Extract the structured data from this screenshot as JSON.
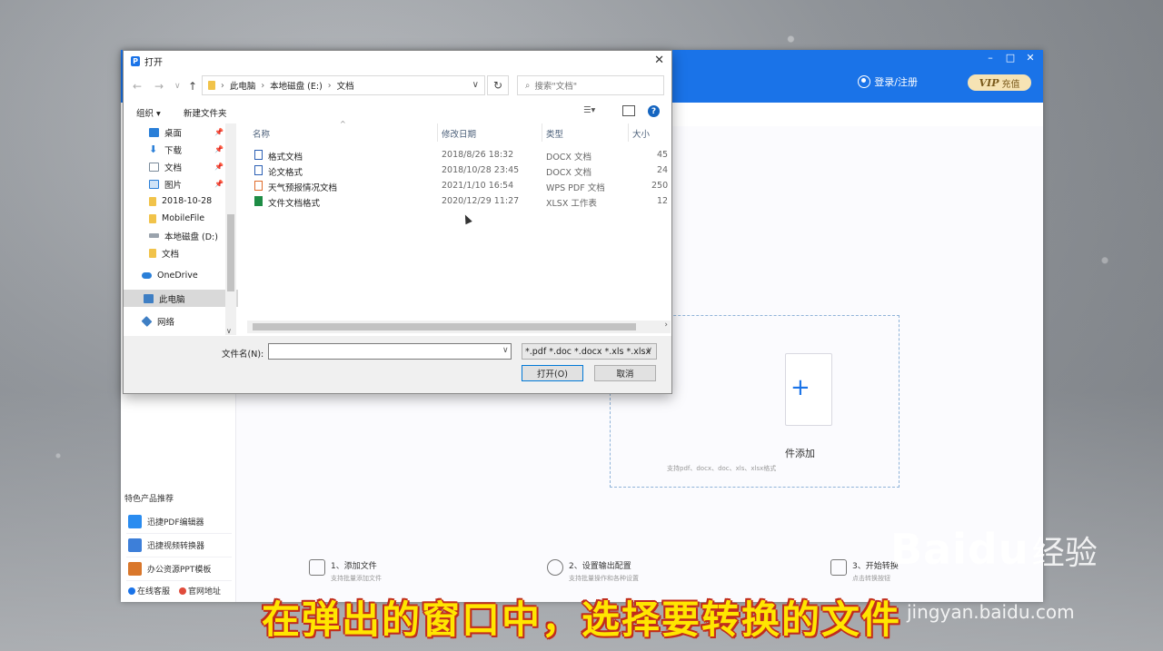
{
  "dialog": {
    "title": "打开",
    "close": "✕",
    "breadcrumb": [
      "此电脑",
      "本地磁盘 (E:)",
      "文档"
    ],
    "search_placeholder": "搜索\"文档\"",
    "toolbar": {
      "organize": "组织 ▾",
      "new_folder": "新建文件夹",
      "help": "?"
    },
    "nav": [
      {
        "label": "桌面",
        "icon": "desktop-icon",
        "pinned": true
      },
      {
        "label": "下载",
        "icon": "download-icon",
        "pinned": true
      },
      {
        "label": "文档",
        "icon": "documents-icon",
        "pinned": true
      },
      {
        "label": "图片",
        "icon": "pictures-icon",
        "pinned": true
      },
      {
        "label": "2018-10-28",
        "icon": "folder-icon",
        "pinned": false
      },
      {
        "label": "MobileFile",
        "icon": "folder-icon",
        "pinned": false
      },
      {
        "label": "本地磁盘 (D:)",
        "icon": "drive-icon",
        "pinned": false
      },
      {
        "label": "文档",
        "icon": "folder-icon",
        "pinned": false
      },
      {
        "label": "OneDrive",
        "icon": "onedrive-icon",
        "pinned": false
      },
      {
        "label": "此电脑",
        "icon": "computer-icon",
        "pinned": false
      },
      {
        "label": "网络",
        "icon": "network-icon",
        "pinned": false
      }
    ],
    "columns": {
      "name": "名称",
      "date": "修改日期",
      "type": "类型",
      "size": "大小"
    },
    "files": [
      {
        "name": "格式文档",
        "date": "2018/8/26 18:32",
        "type": "DOCX 文档",
        "size": "45",
        "color": "#2b5fb4"
      },
      {
        "name": "论文格式",
        "date": "2018/10/28 23:45",
        "type": "DOCX 文档",
        "size": "24",
        "color": "#2b5fb4"
      },
      {
        "name": "天气预报情况文档",
        "date": "2021/1/10 16:54",
        "type": "WPS PDF 文档",
        "size": "250",
        "color": "#e06b2a"
      },
      {
        "name": "文件文档格式",
        "date": "2020/12/29 11:27",
        "type": "XLSX 工作表",
        "size": "12",
        "color": "#1e8c45"
      }
    ],
    "filename_label": "文件名(N):",
    "filename_value": "",
    "filter": "*.pdf *.doc *.docx *.xls *.xlsx",
    "open_btn": "打开(O)",
    "cancel_btn": "取消"
  },
  "app": {
    "window_controls": [
      "–",
      "□",
      "✕"
    ],
    "login": "登录/注册",
    "vip": "VIP",
    "vip_suffix": "充值",
    "add_file_text": "件添加",
    "add_file_sub": "支持pdf、docx、doc、xls、xlsx格式",
    "promo_title": "特色产品推荐",
    "promos": [
      {
        "label": "迅捷PDF编辑器",
        "color": "#2a8cf0"
      },
      {
        "label": "迅捷视频转换器",
        "color": "#2a8cf0"
      },
      {
        "label": "办公资源PPT模板",
        "color": "#d9772b"
      }
    ],
    "footer": [
      "在线客服",
      "官网地址"
    ],
    "steps": [
      {
        "title": "1、添加文件",
        "sub": "支持批量添加文件"
      },
      {
        "title": "2、设置输出配置",
        "sub": "支持批量操作和各种设置"
      },
      {
        "title": "3、开始转换",
        "sub": "点击转换按钮"
      }
    ]
  },
  "subtitle": "在弹出的窗口中，选择要转换的文件",
  "watermark": {
    "main": "Baidu",
    "cn": "经验",
    "sub": "jingyan.baidu.com"
  }
}
